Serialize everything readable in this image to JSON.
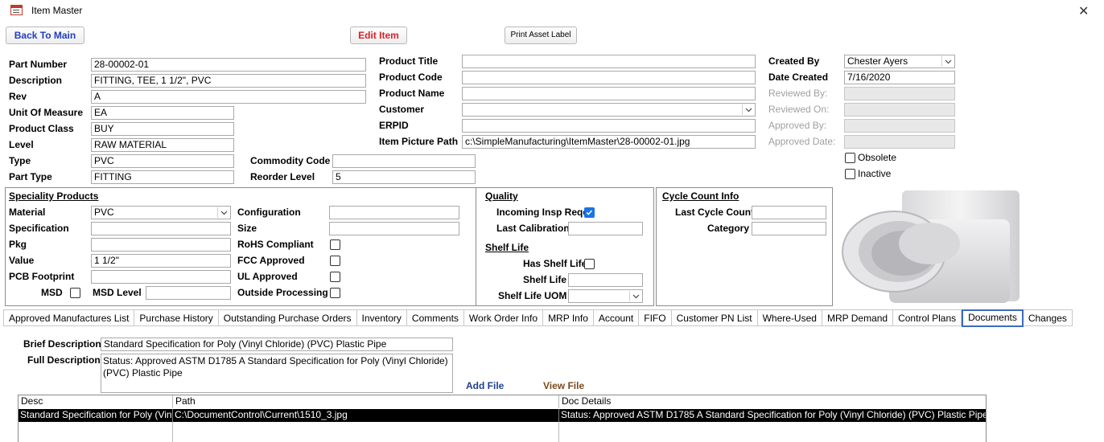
{
  "window": {
    "title": "Item Master",
    "close_glyph": "✕"
  },
  "toolbar": {
    "back": "Back To Main",
    "edit": "Edit Item",
    "print": "Print Asset Label",
    "back_color": "#1f3fbf",
    "edit_color": "#d6252a"
  },
  "item": {
    "part_number": {
      "label": "Part Number",
      "value": "28-00002-01"
    },
    "description": {
      "label": "Description",
      "value": "FITTING, TEE, 1 1/2\", PVC"
    },
    "rev": {
      "label": "Rev",
      "value": "A"
    },
    "uom": {
      "label": "Unit Of Measure",
      "value": "EA"
    },
    "product_class": {
      "label": "Product Class",
      "value": "BUY"
    },
    "level": {
      "label": "Level",
      "value": "RAW MATERIAL"
    },
    "type": {
      "label": "Type",
      "value": "PVC"
    },
    "part_type": {
      "label": "Part Type",
      "value": "FITTING"
    },
    "commodity_code": {
      "label": "Commodity Code",
      "value": ""
    },
    "reorder_level": {
      "label": "Reorder Level",
      "value": "5"
    }
  },
  "product": {
    "title": {
      "label": "Product Title",
      "value": ""
    },
    "code": {
      "label": "Product Code",
      "value": ""
    },
    "name": {
      "label": "Product Name",
      "value": ""
    },
    "customer": {
      "label": "Customer",
      "value": ""
    },
    "erpid": {
      "label": "ERPID",
      "value": ""
    },
    "picture_path": {
      "label": "Item Picture Path",
      "value": "c:\\SimpleManufacturing\\ItemMaster\\28-00002-01.jpg"
    }
  },
  "audit": {
    "created_by": {
      "label": "Created By",
      "value": "Chester Ayers"
    },
    "date_created": {
      "label": "Date Created",
      "value": "7/16/2020"
    },
    "reviewed_by": {
      "label": "Reviewed By:",
      "value": ""
    },
    "reviewed_on": {
      "label": "Reviewed On:",
      "value": ""
    },
    "approved_by": {
      "label": "Approved By:",
      "value": ""
    },
    "approved_date": {
      "label": "Approved Date:",
      "value": ""
    },
    "obsolete": {
      "label": "Obsolete",
      "checked": false
    },
    "inactive": {
      "label": "Inactive",
      "checked": false
    }
  },
  "speciality": {
    "heading": "Speciality Products",
    "material": {
      "label": "Material",
      "value": "PVC"
    },
    "specification": {
      "label": "Specification",
      "value": ""
    },
    "pkg": {
      "label": "Pkg",
      "value": ""
    },
    "value": {
      "label": "Value",
      "value": "1 1/2\""
    },
    "pcb_footprint": {
      "label": "PCB Footprint",
      "value": ""
    },
    "msd": {
      "label": "MSD",
      "checked": false
    },
    "msd_level": {
      "label": "MSD Level",
      "value": ""
    },
    "configuration": {
      "label": "Configuration",
      "value": ""
    },
    "size": {
      "label": "Size",
      "value": ""
    },
    "rohs": {
      "label": "RoHS Compliant",
      "checked": false
    },
    "fcc": {
      "label": "FCC Approved",
      "checked": false
    },
    "ul": {
      "label": "UL Approved",
      "checked": false
    },
    "outside": {
      "label": "Outside Processing",
      "checked": false
    }
  },
  "quality": {
    "heading": "Quality",
    "incoming_insp": {
      "label": "Incoming Insp Reqd",
      "checked": true
    },
    "last_calibration": {
      "label": "Last Calibration",
      "value": ""
    },
    "shelf_heading": "Shelf Life",
    "has_shelf_life": {
      "label": "Has Shelf Life",
      "checked": false
    },
    "shelf_life": {
      "label": "Shelf Life",
      "value": ""
    },
    "shelf_life_uom": {
      "label": "Shelf Life UOM",
      "value": ""
    }
  },
  "cycle": {
    "heading": "Cycle Count Info",
    "last_cycle_count": {
      "label": "Last Cycle Count",
      "value": ""
    },
    "category": {
      "label": "Category",
      "value": ""
    }
  },
  "tabs": [
    "Approved Manufactures List",
    "Purchase History",
    "Outstanding Purchase Orders",
    "Inventory",
    "Comments",
    "Work Order Info",
    "MRP Info",
    "Account",
    "FIFO",
    "Customer PN List",
    "Where-Used",
    "MRP Demand",
    "Control Plans",
    "Documents",
    "Changes"
  ],
  "active_tab": "Documents",
  "documents": {
    "brief": {
      "label": "Brief Description",
      "value": "Standard Specification for Poly (Vinyl Chloride) (PVC) Plastic Pipe"
    },
    "full": {
      "label": "Full Description",
      "value": "Status: Approved ASTM D1785 A  Standard Specification for Poly (Vinyl Chloride) (PVC) Plastic Pipe"
    },
    "add_file": "Add File",
    "view_file": "View File",
    "add_color": "#1f3f8f",
    "view_color": "#7a4a1a",
    "columns": [
      "Desc",
      "Path",
      "Doc Details"
    ],
    "rows": [
      [
        "Standard Specification for Poly (Vinyl Chloride) (PVC) Plastic Pipe",
        "C:\\DocumentControl\\Current\\1510_3.jpg",
        "Status: Approved ASTM D1785 A  Standard Specification for Poly (Vinyl Chloride) (PVC) Plastic Pipe"
      ]
    ]
  },
  "icons": {
    "app": "form-window-icon",
    "close": "close-icon",
    "dropdown": "chevron-down-icon",
    "check": "checkmark-icon"
  }
}
